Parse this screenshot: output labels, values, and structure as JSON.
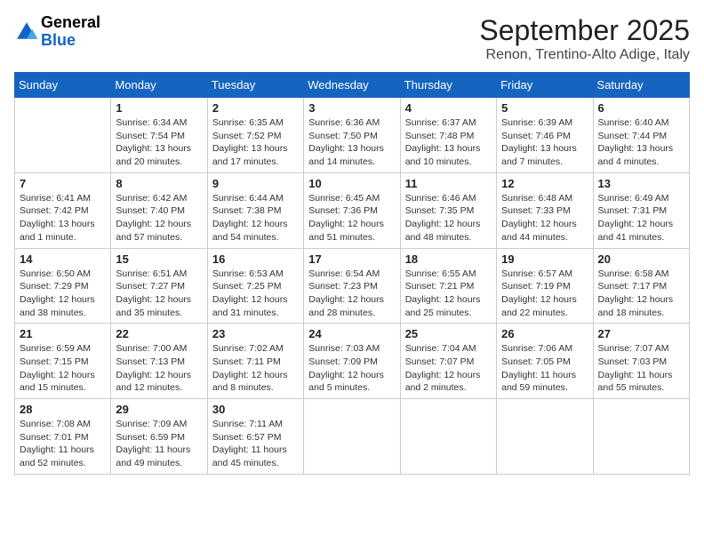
{
  "header": {
    "logo_line1": "General",
    "logo_line2": "Blue",
    "title": "September 2025",
    "subtitle": "Renon, Trentino-Alto Adige, Italy"
  },
  "weekdays": [
    "Sunday",
    "Monday",
    "Tuesday",
    "Wednesday",
    "Thursday",
    "Friday",
    "Saturday"
  ],
  "weeks": [
    [
      {
        "day": "",
        "info": ""
      },
      {
        "day": "1",
        "info": "Sunrise: 6:34 AM\nSunset: 7:54 PM\nDaylight: 13 hours\nand 20 minutes."
      },
      {
        "day": "2",
        "info": "Sunrise: 6:35 AM\nSunset: 7:52 PM\nDaylight: 13 hours\nand 17 minutes."
      },
      {
        "day": "3",
        "info": "Sunrise: 6:36 AM\nSunset: 7:50 PM\nDaylight: 13 hours\nand 14 minutes."
      },
      {
        "day": "4",
        "info": "Sunrise: 6:37 AM\nSunset: 7:48 PM\nDaylight: 13 hours\nand 10 minutes."
      },
      {
        "day": "5",
        "info": "Sunrise: 6:39 AM\nSunset: 7:46 PM\nDaylight: 13 hours\nand 7 minutes."
      },
      {
        "day": "6",
        "info": "Sunrise: 6:40 AM\nSunset: 7:44 PM\nDaylight: 13 hours\nand 4 minutes."
      }
    ],
    [
      {
        "day": "7",
        "info": "Sunrise: 6:41 AM\nSunset: 7:42 PM\nDaylight: 13 hours\nand 1 minute."
      },
      {
        "day": "8",
        "info": "Sunrise: 6:42 AM\nSunset: 7:40 PM\nDaylight: 12 hours\nand 57 minutes."
      },
      {
        "day": "9",
        "info": "Sunrise: 6:44 AM\nSunset: 7:38 PM\nDaylight: 12 hours\nand 54 minutes."
      },
      {
        "day": "10",
        "info": "Sunrise: 6:45 AM\nSunset: 7:36 PM\nDaylight: 12 hours\nand 51 minutes."
      },
      {
        "day": "11",
        "info": "Sunrise: 6:46 AM\nSunset: 7:35 PM\nDaylight: 12 hours\nand 48 minutes."
      },
      {
        "day": "12",
        "info": "Sunrise: 6:48 AM\nSunset: 7:33 PM\nDaylight: 12 hours\nand 44 minutes."
      },
      {
        "day": "13",
        "info": "Sunrise: 6:49 AM\nSunset: 7:31 PM\nDaylight: 12 hours\nand 41 minutes."
      }
    ],
    [
      {
        "day": "14",
        "info": "Sunrise: 6:50 AM\nSunset: 7:29 PM\nDaylight: 12 hours\nand 38 minutes."
      },
      {
        "day": "15",
        "info": "Sunrise: 6:51 AM\nSunset: 7:27 PM\nDaylight: 12 hours\nand 35 minutes."
      },
      {
        "day": "16",
        "info": "Sunrise: 6:53 AM\nSunset: 7:25 PM\nDaylight: 12 hours\nand 31 minutes."
      },
      {
        "day": "17",
        "info": "Sunrise: 6:54 AM\nSunset: 7:23 PM\nDaylight: 12 hours\nand 28 minutes."
      },
      {
        "day": "18",
        "info": "Sunrise: 6:55 AM\nSunset: 7:21 PM\nDaylight: 12 hours\nand 25 minutes."
      },
      {
        "day": "19",
        "info": "Sunrise: 6:57 AM\nSunset: 7:19 PM\nDaylight: 12 hours\nand 22 minutes."
      },
      {
        "day": "20",
        "info": "Sunrise: 6:58 AM\nSunset: 7:17 PM\nDaylight: 12 hours\nand 18 minutes."
      }
    ],
    [
      {
        "day": "21",
        "info": "Sunrise: 6:59 AM\nSunset: 7:15 PM\nDaylight: 12 hours\nand 15 minutes."
      },
      {
        "day": "22",
        "info": "Sunrise: 7:00 AM\nSunset: 7:13 PM\nDaylight: 12 hours\nand 12 minutes."
      },
      {
        "day": "23",
        "info": "Sunrise: 7:02 AM\nSunset: 7:11 PM\nDaylight: 12 hours\nand 8 minutes."
      },
      {
        "day": "24",
        "info": "Sunrise: 7:03 AM\nSunset: 7:09 PM\nDaylight: 12 hours\nand 5 minutes."
      },
      {
        "day": "25",
        "info": "Sunrise: 7:04 AM\nSunset: 7:07 PM\nDaylight: 12 hours\nand 2 minutes."
      },
      {
        "day": "26",
        "info": "Sunrise: 7:06 AM\nSunset: 7:05 PM\nDaylight: 11 hours\nand 59 minutes."
      },
      {
        "day": "27",
        "info": "Sunrise: 7:07 AM\nSunset: 7:03 PM\nDaylight: 11 hours\nand 55 minutes."
      }
    ],
    [
      {
        "day": "28",
        "info": "Sunrise: 7:08 AM\nSunset: 7:01 PM\nDaylight: 11 hours\nand 52 minutes."
      },
      {
        "day": "29",
        "info": "Sunrise: 7:09 AM\nSunset: 6:59 PM\nDaylight: 11 hours\nand 49 minutes."
      },
      {
        "day": "30",
        "info": "Sunrise: 7:11 AM\nSunset: 6:57 PM\nDaylight: 11 hours\nand 45 minutes."
      },
      {
        "day": "",
        "info": ""
      },
      {
        "day": "",
        "info": ""
      },
      {
        "day": "",
        "info": ""
      },
      {
        "day": "",
        "info": ""
      }
    ]
  ]
}
